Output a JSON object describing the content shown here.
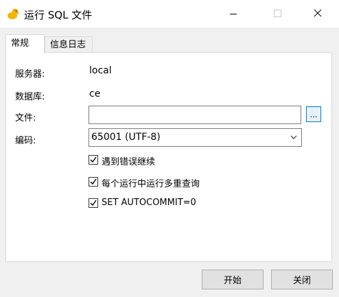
{
  "window": {
    "title": "运行 SQL 文件",
    "accent_color": "#0078d7",
    "icon": "app-logo-icon"
  },
  "tabs": [
    {
      "label": "常规",
      "active": true
    },
    {
      "label": "信息日志",
      "active": false
    }
  ],
  "form": {
    "server_label": "服务器:",
    "server_value": "local",
    "database_label": "数据库:",
    "database_value": "ce",
    "file_label": "文件:",
    "file_value": "",
    "browse_label": "...",
    "encoding_label": "编码:",
    "encoding_value": "65001 (UTF-8)"
  },
  "options": [
    {
      "label": "遇到错误继续",
      "checked": true
    },
    {
      "label": "每个运行中运行多重查询",
      "checked": true
    },
    {
      "label": "SET AUTOCOMMIT=0",
      "checked": true
    }
  ],
  "buttons": {
    "start": "开始",
    "close": "关闭"
  }
}
